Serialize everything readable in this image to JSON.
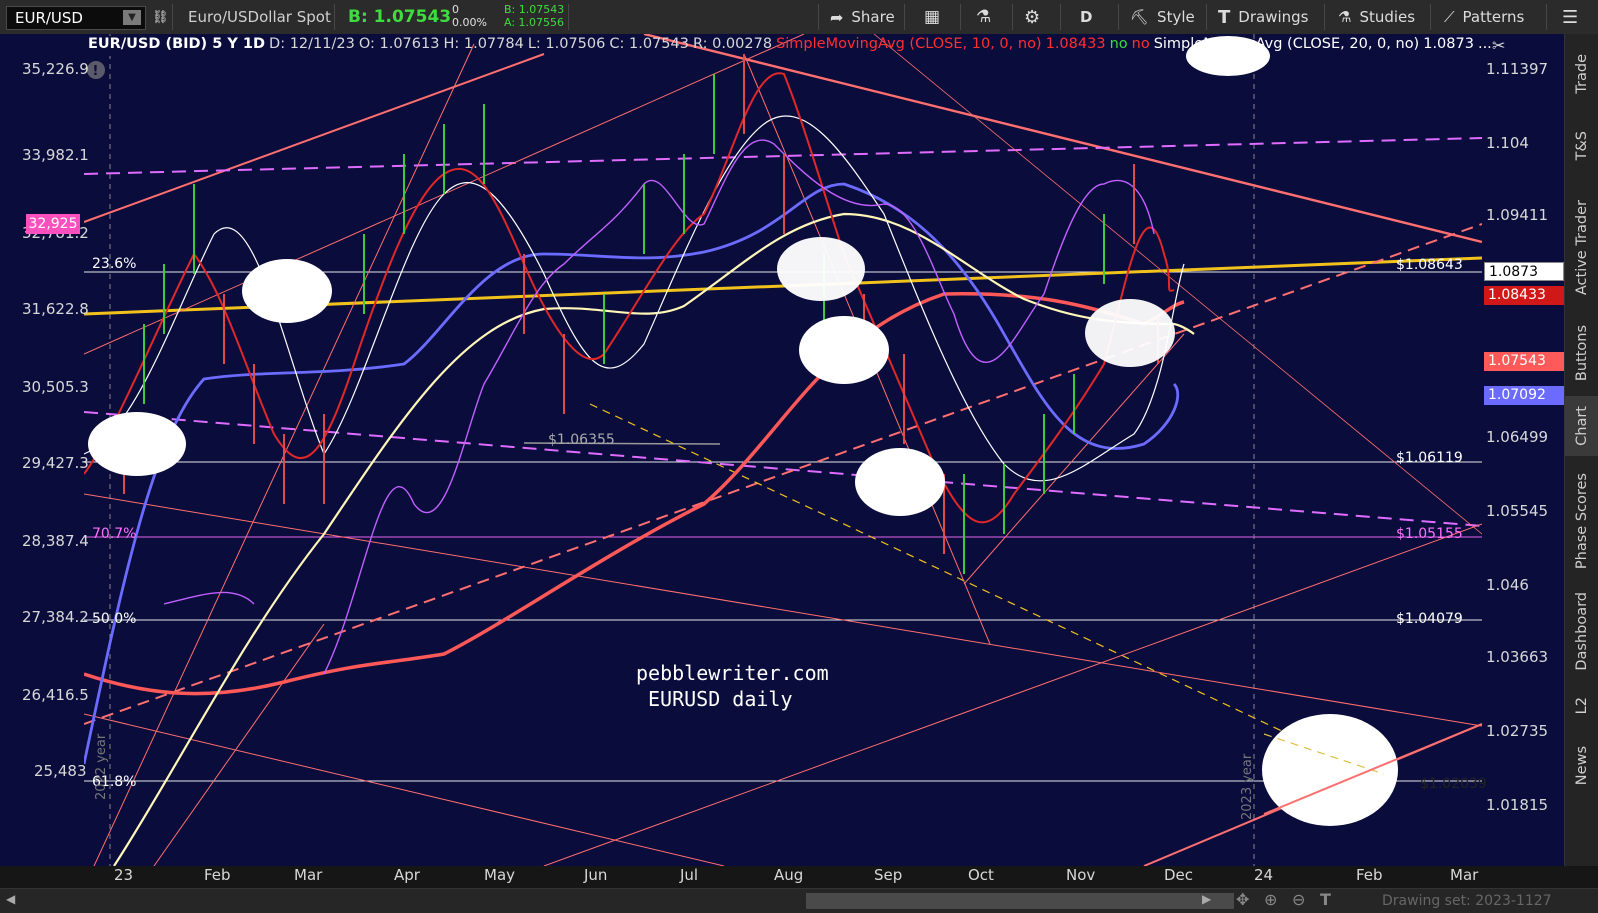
{
  "toolbar": {
    "symbol": "EUR/USD",
    "description": "Euro/USDollar Spot",
    "bid_main": "B: 1.07543",
    "change": "0",
    "change_pct": "0.00%",
    "bid_small": "B: 1.07543",
    "ask_small": "A: 1.07556",
    "share": "Share",
    "period": "D",
    "style": "Style",
    "drawings": "Drawings",
    "studies": "Studies",
    "patterns": "Patterns"
  },
  "info_bar": {
    "title": "EUR/USD (BID) 5 Y 1D",
    "date": "D: 12/11/23",
    "open": "O: 1.07613",
    "high": "H: 1.07784",
    "low": "L: 1.07506",
    "close": "C: 1.07543",
    "range": "R: 0.00278",
    "sma10": "SimpleMovingAvg (CLOSE, 10, 0, no)",
    "sma10_val": "1.08433",
    "no1": "no",
    "no2": "no",
    "sma20": "SimpleMovingAvg (CLOSE, 20, 0, no)",
    "sma20_val": "1.0873",
    "ellipsis": "..."
  },
  "left_axis": [
    "35,226.9",
    "33,982.1",
    "32,781.2",
    "31,622.8",
    "30,505.3",
    "29,427.3",
    "28,387.4",
    "27,384.2",
    "26,416.5",
    "25,483"
  ],
  "left_tag": "32,925",
  "right_axis": [
    "1.11397",
    "1.104",
    "1.09411",
    "1.06499",
    "1.05545",
    "1.046",
    "1.03663",
    "1.02735",
    "1.01815"
  ],
  "right_tags": {
    "sma20": "1.0873",
    "sma10": "1.08433",
    "close": "1.07543",
    "other": "1.07092"
  },
  "x_axis": [
    "23",
    "Feb",
    "Mar",
    "Apr",
    "May",
    "Jun",
    "Jul",
    "Aug",
    "Sep",
    "Oct",
    "Nov",
    "Dec",
    "24",
    "Feb",
    "Mar"
  ],
  "fib_levels": {
    "f236": "23.6%",
    "f707": "70.7%",
    "f50": "50.0%",
    "f618": "61.8%",
    "p1": "$1.08643",
    "p2": "$1.06119",
    "p3": "$1.05155",
    "p4": "$1.04079",
    "p5": "$1.0203",
    "p5_suffix": "9",
    "p6": "$1.06355"
  },
  "year_labels": {
    "y2022": "2022 year",
    "y2023": "2023 year"
  },
  "watermark": {
    "line1": "pebblewriter.com",
    "line2": "EURUSD daily"
  },
  "side_tabs": [
    "Trade",
    "T&S",
    "Active Trader",
    "Buttons",
    "Chart",
    "Phase Scores",
    "Dashboard",
    "L2",
    "News"
  ],
  "bottom": {
    "drawing_set": "Drawing set: 2023-1127"
  },
  "colors": {
    "background": "#0a0c3c",
    "bid": "#3fdc3f",
    "sma10": "#e03030",
    "toolbar": "#2b2b2b"
  }
}
